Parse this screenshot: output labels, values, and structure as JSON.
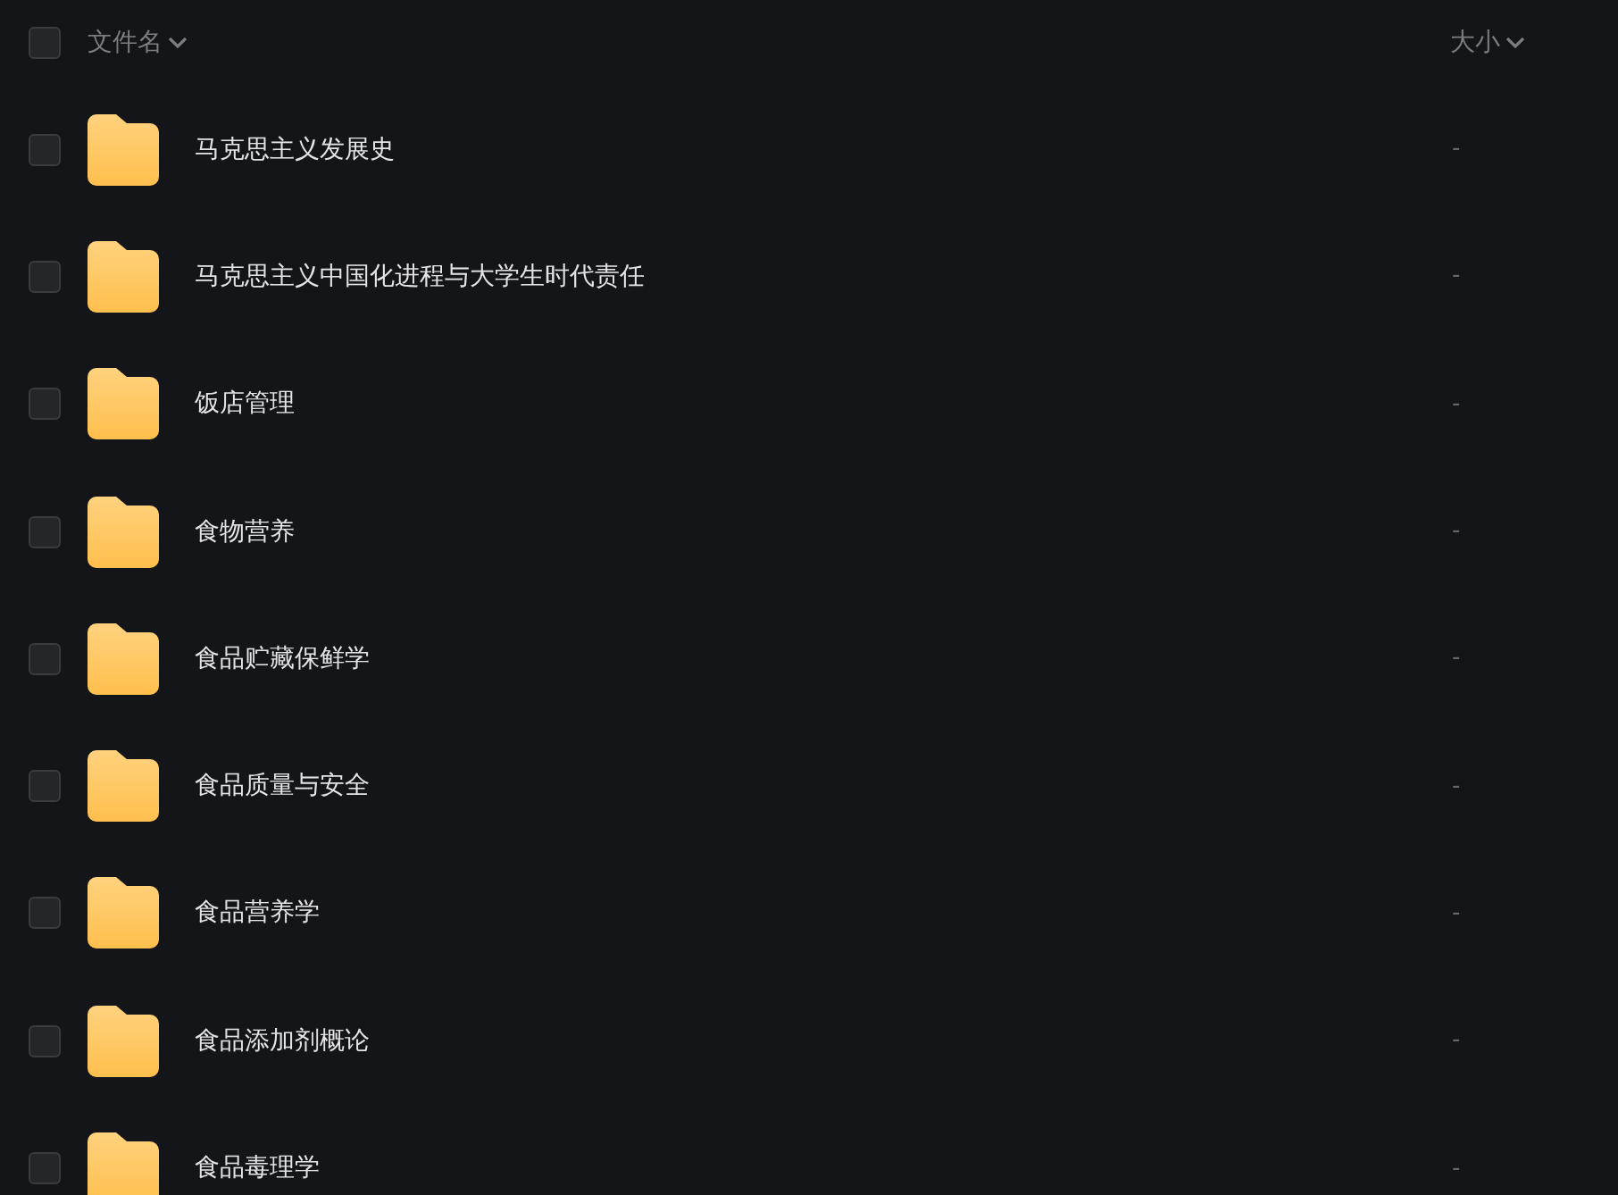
{
  "header": {
    "select_all": {
      "checked": false
    },
    "columns": [
      {
        "label": "文件名"
      },
      {
        "label": "大小"
      }
    ]
  },
  "rows": [
    {
      "name": "马克思主义发展史",
      "size": "-",
      "checked": false
    },
    {
      "name": "马克思主义中国化进程与大学生时代责任",
      "size": "-",
      "checked": false
    },
    {
      "name": "饭店管理",
      "size": "-",
      "checked": false
    },
    {
      "name": "食物营养",
      "size": "-",
      "checked": false
    },
    {
      "name": "食品贮藏保鲜学",
      "size": "-",
      "checked": false
    },
    {
      "name": "食品质量与安全",
      "size": "-",
      "checked": false
    },
    {
      "name": "食品营养学",
      "size": "-",
      "checked": false
    },
    {
      "name": "食品添加剂概论",
      "size": "-",
      "checked": false
    },
    {
      "name": "食品毒理学",
      "size": "-",
      "checked": false
    }
  ]
}
